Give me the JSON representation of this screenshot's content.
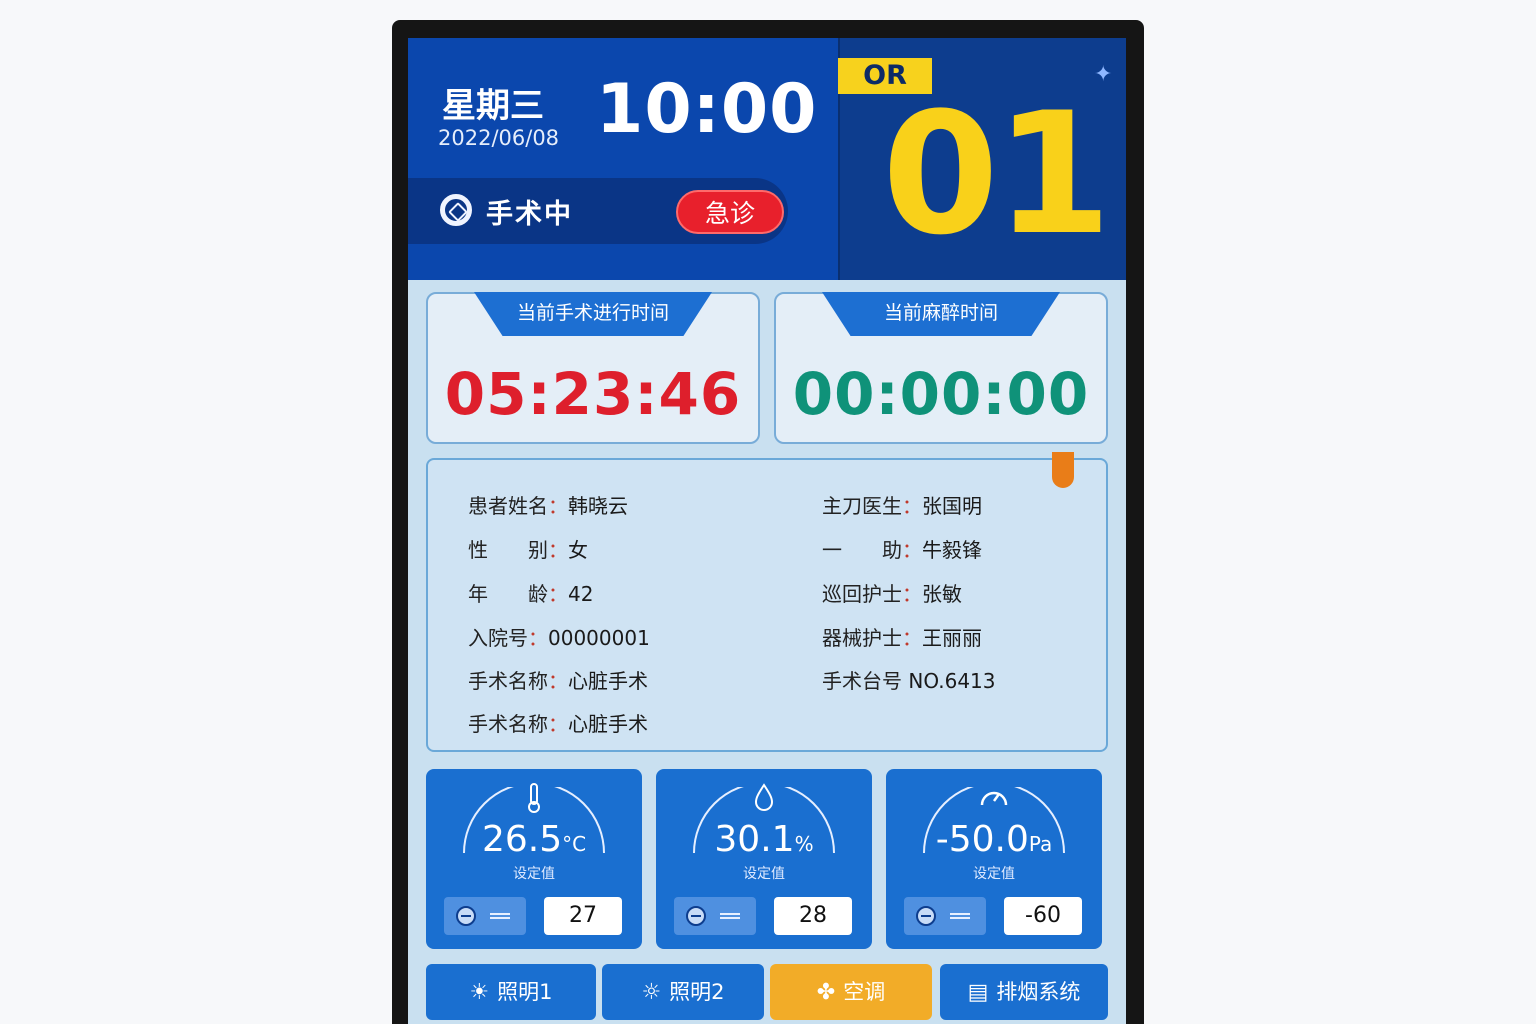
{
  "header": {
    "weekday": "星期三",
    "date": "2022/06/08",
    "time": "10:00",
    "status_text": "手术中",
    "urgent_label": "急诊",
    "room_prefix": "OR",
    "room_number": "01"
  },
  "timers": [
    {
      "label": "当前手术进行时间",
      "value": "05:23:46",
      "color": "#de1f2c"
    },
    {
      "label": "当前麻醉时间",
      "value": "00:00:00",
      "color": "#0f9279"
    }
  ],
  "patient_info": {
    "left": [
      {
        "label": "患者姓名",
        "value": "韩晓云"
      },
      {
        "label": "性　　别",
        "value": "女"
      },
      {
        "label": "年　　龄",
        "value": "42"
      },
      {
        "label": "入院号",
        "value": "00000001"
      },
      {
        "label": "手术名称",
        "value": "心脏手术"
      },
      {
        "label": "手术名称",
        "value": "心脏手术"
      }
    ],
    "right": [
      {
        "label": "主刀医生",
        "value": "张国明"
      },
      {
        "label": "一　　助",
        "value": "牛毅锋"
      },
      {
        "label": "巡回护士",
        "value": "张敏"
      },
      {
        "label": "器械护士",
        "value": "王丽丽"
      },
      {
        "label": "手术台号",
        "value": "NO.6413"
      }
    ]
  },
  "sensors": [
    {
      "icon": "thermometer-icon",
      "value": "26.5",
      "unit": "°C",
      "label": "设定值",
      "setpoint": "27"
    },
    {
      "icon": "droplet-icon",
      "value": "30.1",
      "unit": "%",
      "label": "设定值",
      "setpoint": "28"
    },
    {
      "icon": "gauge-icon",
      "value": "-50.0",
      "unit": "Pa",
      "label": "设定值",
      "setpoint": "-60"
    }
  ],
  "buttons": [
    {
      "icon": "sun-icon",
      "label": "照明1",
      "active": false
    },
    {
      "icon": "sun-icon",
      "label": "照明2",
      "active": false
    },
    {
      "icon": "fan-icon",
      "label": "空调",
      "active": true
    },
    {
      "icon": "display-icon",
      "label": "排烟系统",
      "active": false
    }
  ],
  "colors": {
    "header_blue": "#0b47ad",
    "accent_yellow": "#f9d11a",
    "alert_red": "#e8202c",
    "active_orange": "#f2ac28"
  }
}
